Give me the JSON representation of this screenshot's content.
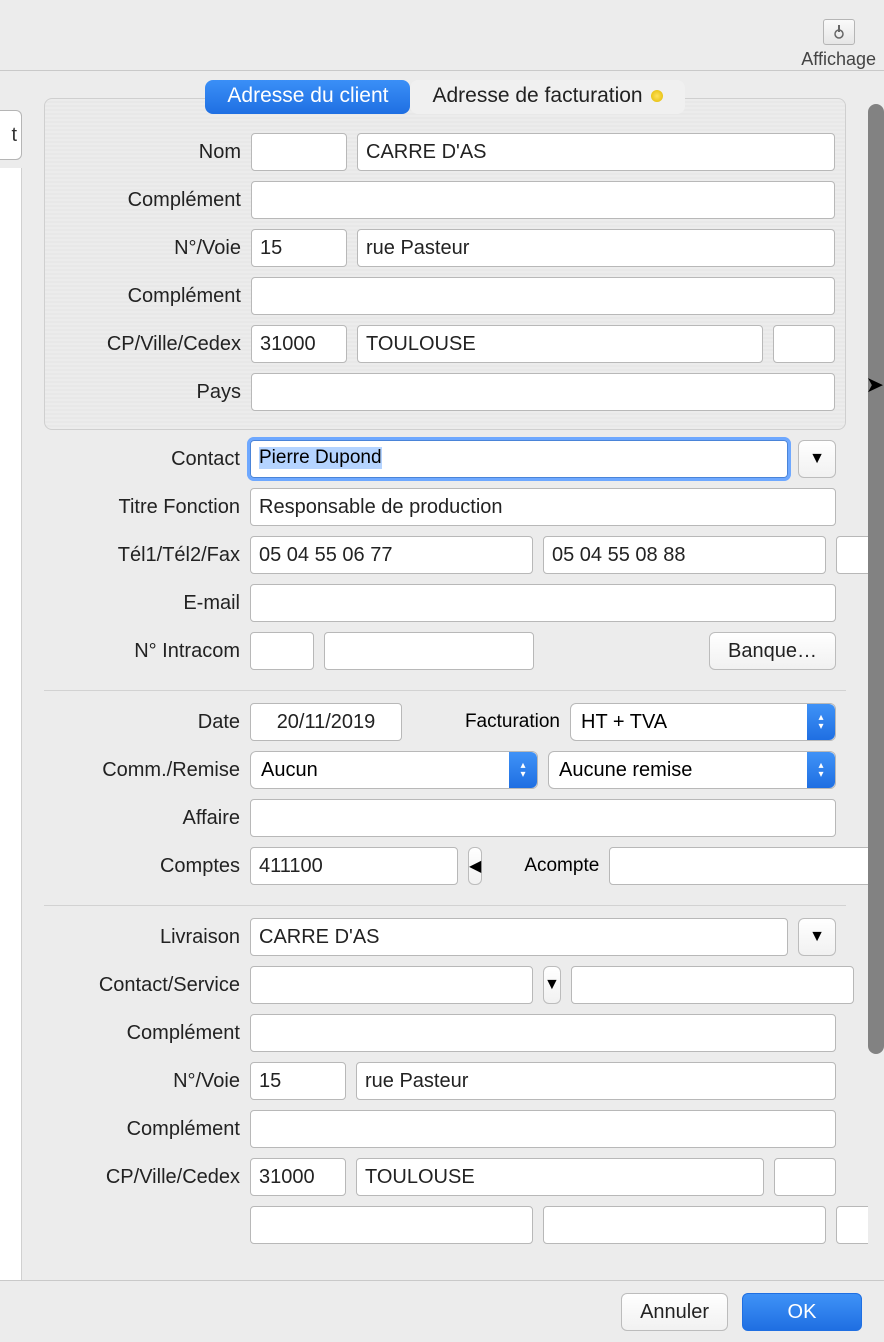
{
  "toolbar": {
    "affichage": "Affichage"
  },
  "left_stub": "t",
  "tabs": {
    "client": "Adresse du client",
    "billing": "Adresse de facturation"
  },
  "labels": {
    "nom": "Nom",
    "complement": "Complément",
    "nvoie": "N°/Voie",
    "cpville": "CP/Ville/Cedex",
    "pays": "Pays",
    "contact": "Contact",
    "titre": "Titre Fonction",
    "tel": "Tél1/Tél2/Fax",
    "email": "E-mail",
    "intracom": "N° Intracom",
    "banque": "Banque…",
    "date": "Date",
    "facturation": "Facturation",
    "commremise": "Comm./Remise",
    "affaire": "Affaire",
    "comptes": "Comptes",
    "acompte": "Acompte",
    "livraison": "Livraison",
    "contactservice": "Contact/Service"
  },
  "client": {
    "nom_prefix": "",
    "nom": "CARRE D'AS",
    "complement1": "",
    "num": "15",
    "voie": "rue Pasteur",
    "complement2": "",
    "cp": "31000",
    "ville": "TOULOUSE",
    "cedex": "",
    "pays": ""
  },
  "contact": {
    "name": "Pierre Dupond",
    "titre": "Responsable de production",
    "tel1": "05 04 55 06 77",
    "tel2": "05 04 55 08 88",
    "fax": "",
    "email": "",
    "intracom1": "",
    "intracom2": ""
  },
  "dossier": {
    "date": "20/11/2019",
    "facturation_sel": "HT + TVA",
    "comm_sel": "Aucun",
    "remise_sel": "Aucune remise",
    "affaire": "",
    "compte": "411100",
    "acompte": ""
  },
  "livraison": {
    "nom": "CARRE D'AS",
    "contact": "",
    "service": "",
    "complement1": "",
    "num": "15",
    "voie": "rue Pasteur",
    "complement2": "",
    "cp": "31000",
    "ville": "TOULOUSE",
    "cedex": ""
  },
  "footer": {
    "cancel": "Annuler",
    "ok": "OK"
  }
}
